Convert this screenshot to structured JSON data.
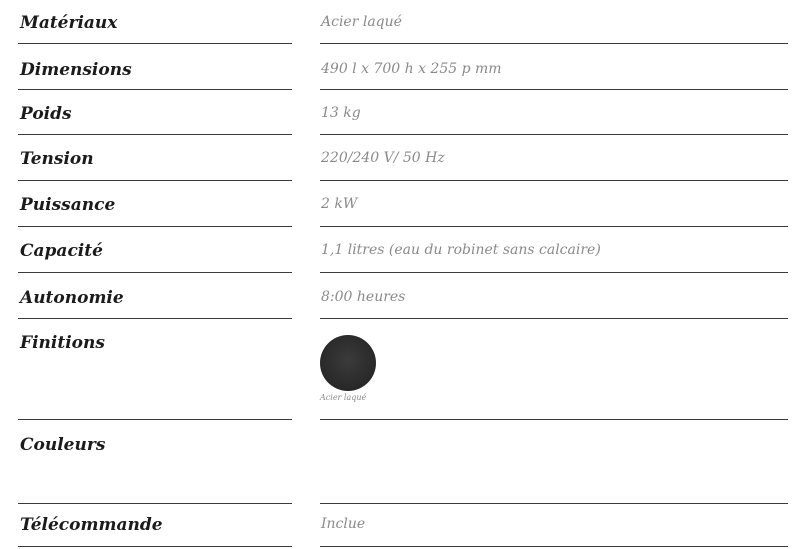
{
  "specs": {
    "rows": [
      {
        "label": "Matériaux",
        "value": "Acier laqué"
      },
      {
        "label": "Dimensions",
        "value": "490 l x 700 h x 255 p mm"
      },
      {
        "label": "Poids",
        "value": "13 kg"
      },
      {
        "label": "Tension",
        "value": "220/240 V/ 50 Hz"
      },
      {
        "label": "Puissance",
        "value": "2 kW"
      },
      {
        "label": "Capacité",
        "value": "1,1 litres (eau du robinet sans calcaire)"
      },
      {
        "label": "Autonomie",
        "value": "8:00 heures"
      },
      {
        "label": "Finitions",
        "value": ""
      },
      {
        "label": "Couleurs",
        "value": ""
      },
      {
        "label": "Télécommande",
        "value": "Inclue"
      }
    ],
    "finish_swatch": {
      "label": "Acier laqué",
      "color": "#2c2c2c"
    }
  }
}
